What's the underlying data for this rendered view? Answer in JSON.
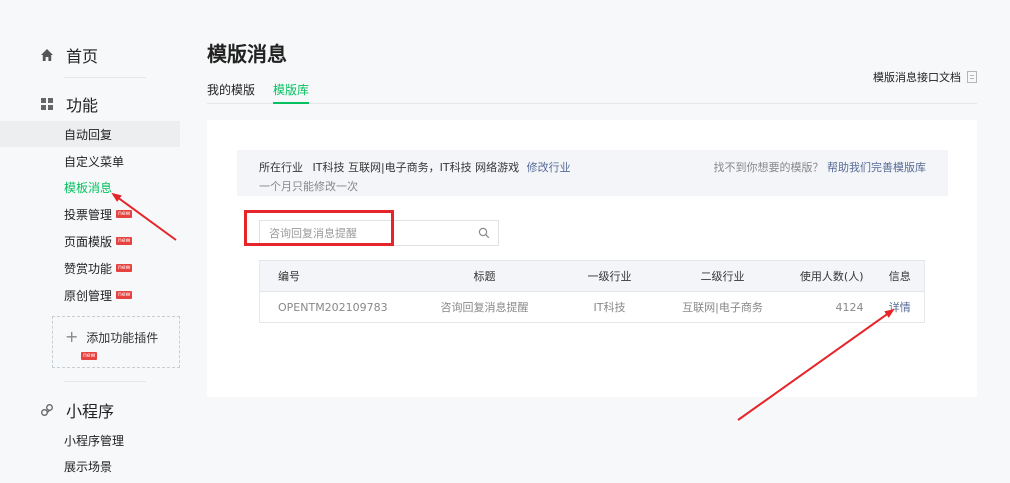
{
  "sidebar": {
    "home": {
      "label": "首页",
      "icon": "home-icon"
    },
    "function": {
      "label": "功能",
      "icon": "grid-icon",
      "items": [
        {
          "label": "自动回复",
          "new": false
        },
        {
          "label": "自定义菜单",
          "new": false
        },
        {
          "label": "模板消息",
          "new": false
        },
        {
          "label": "投票管理",
          "new": true
        },
        {
          "label": "页面模版",
          "new": true
        },
        {
          "label": "赞赏功能",
          "new": true
        },
        {
          "label": "原创管理",
          "new": true
        }
      ],
      "add_plugin": {
        "label": "添加功能插件",
        "new": true
      }
    },
    "miniprogram": {
      "label": "小程序",
      "icon": "link-icon",
      "items": [
        {
          "label": "小程序管理"
        },
        {
          "label": "展示场景"
        }
      ]
    },
    "new_badge": "new"
  },
  "main": {
    "title": "模版消息",
    "tabs": [
      {
        "label": "我的模版"
      },
      {
        "label": "模版库"
      }
    ],
    "doc_link": "模版消息接口文档",
    "industry": {
      "prefix": "所在行业",
      "value": "IT科技 互联网|电子商务，IT科技 网络游戏",
      "modify": "修改行业",
      "note": "一个月只能修改一次",
      "help_text": "找不到你想要的模版？",
      "help_link": "帮助我们完善模版库"
    },
    "search": {
      "value": "",
      "placeholder": "咨询回复消息提醒"
    },
    "table": {
      "headers": {
        "id": "编号",
        "title": "标题",
        "industry1": "一级行业",
        "industry2": "二级行业",
        "users": "使用人数(人)",
        "info": "信息"
      },
      "rows": [
        {
          "id": "OPENTM202109783",
          "title": "咨询回复消息提醒",
          "industry1": "IT科技",
          "industry2": "互联网|电子商务",
          "users": "4124",
          "info": "详情"
        }
      ]
    }
  },
  "colors": {
    "accent": "#07c160",
    "link": "#576b95",
    "annotation": "#e6252a",
    "badge": "#e64340"
  }
}
